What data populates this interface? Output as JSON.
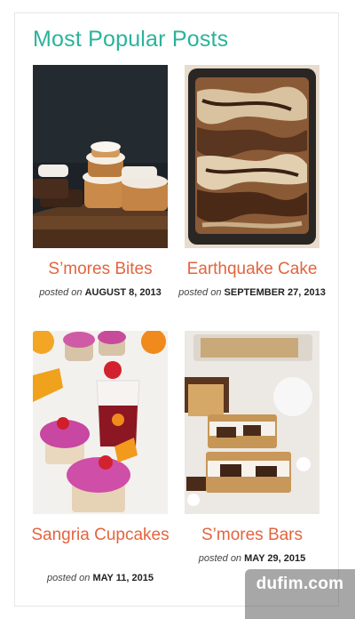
{
  "widget": {
    "title": "Most Popular Posts"
  },
  "posts": [
    {
      "title": "S’mores Bites",
      "date_label": "posted on",
      "date": "AUGUST 8, 2013"
    },
    {
      "title": "Earthquake Cake",
      "date_label": "posted on",
      "date": "SEPTEMBER 27, 2013"
    },
    {
      "title": "Sangria Cupcakes",
      "date_label": "posted on",
      "date": "MAY 11, 2015"
    },
    {
      "title": "S’mores Bars",
      "date_label": "posted on",
      "date": "MAY 29, 2015"
    }
  ],
  "watermark": {
    "text": "dufim.com"
  },
  "colors": {
    "heading": "#2bb39a",
    "post_title": "#e2653e"
  }
}
